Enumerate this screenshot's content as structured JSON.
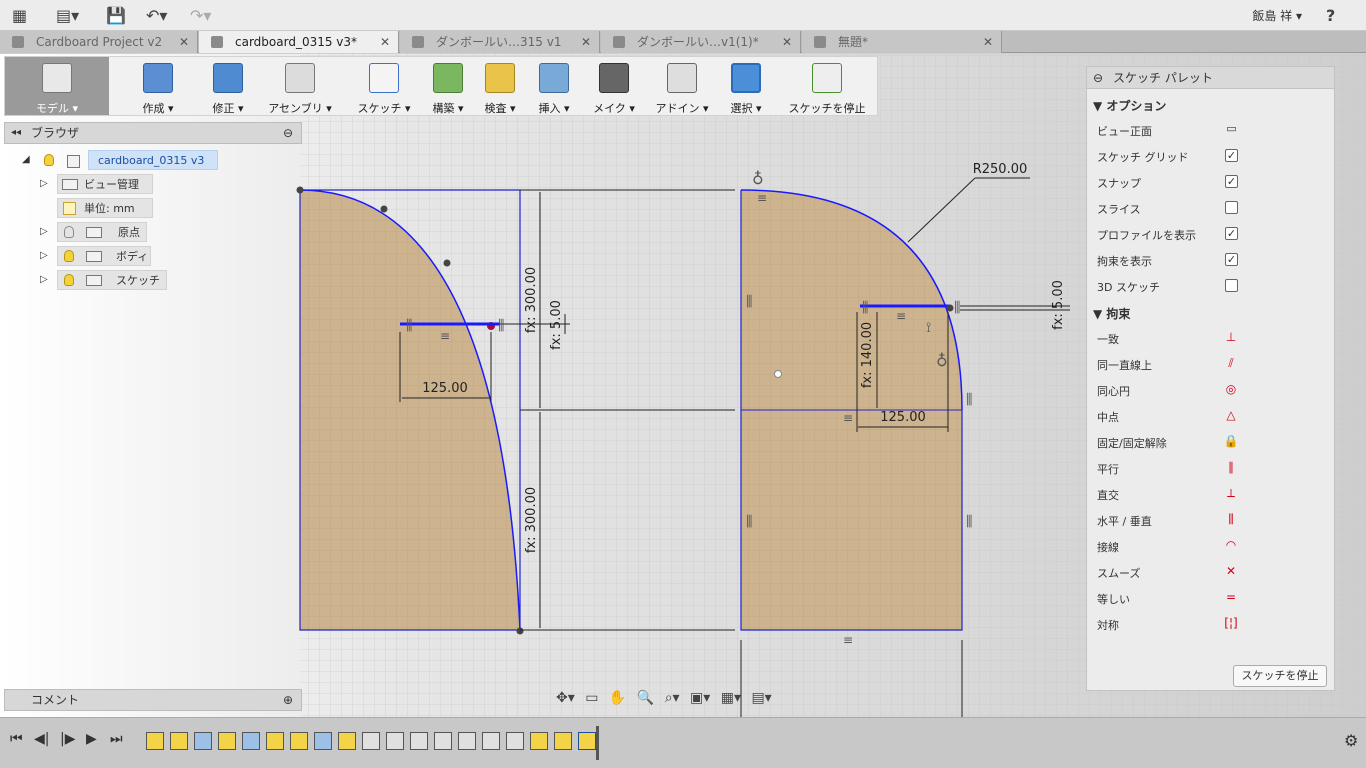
{
  "user": {
    "name": "飯島 祥 ▾",
    "help": "?"
  },
  "tabs": [
    {
      "label": "Cardboard Project v2",
      "close": "✕"
    },
    {
      "label": "cardboard_0315 v3*",
      "close": "✕"
    },
    {
      "label": "ダンボールい…315 v1",
      "close": "✕"
    },
    {
      "label": "ダンボールい…v1(1)*",
      "close": "✕"
    },
    {
      "label": "無題*",
      "close": "✕"
    }
  ],
  "toolbar": [
    {
      "label": "モデル ▾"
    },
    {
      "label": "作成 ▾"
    },
    {
      "label": "修正 ▾"
    },
    {
      "label": "アセンブリ ▾"
    },
    {
      "label": "スケッチ ▾"
    },
    {
      "label": "構築 ▾"
    },
    {
      "label": "検査 ▾"
    },
    {
      "label": "挿入 ▾"
    },
    {
      "label": "メイク ▾"
    },
    {
      "label": "アドイン ▾"
    },
    {
      "label": "選択 ▾"
    },
    {
      "label": "スケッチを停止"
    }
  ],
  "browser": {
    "title": "ブラウザ",
    "root": "cardboard_0315 v3",
    "items": [
      "ビュー管理",
      "単位: mm",
      "原点",
      "ボディ",
      "スケッチ"
    ]
  },
  "comment": {
    "title": "コメント"
  },
  "sketch": {
    "dims": {
      "radius": "R250.00",
      "left_h": "125.00",
      "left_v1": "fx: 300.00",
      "left_v2": "fx: 300.00",
      "left_small": "fx: 5.00",
      "right_h": "125.00",
      "right_v": "fx: 140.00",
      "right_small": "fx: 5.00"
    }
  },
  "palette": {
    "title": "スケッチ パレット",
    "options_title": "オプション",
    "options": [
      {
        "label": "ビュー正面",
        "checked": null
      },
      {
        "label": "スケッチ グリッド",
        "checked": true
      },
      {
        "label": "スナップ",
        "checked": true
      },
      {
        "label": "スライス",
        "checked": false
      },
      {
        "label": "プロファイルを表示",
        "checked": true
      },
      {
        "label": "拘束を表示",
        "checked": true
      },
      {
        "label": "3D スケッチ",
        "checked": false
      }
    ],
    "constraints_title": "拘束",
    "constraints": [
      {
        "label": "一致",
        "icon": "coincident-icon"
      },
      {
        "label": "同一直線上",
        "icon": "collinear-icon"
      },
      {
        "label": "同心円",
        "icon": "concentric-icon"
      },
      {
        "label": "中点",
        "icon": "midpoint-icon"
      },
      {
        "label": "固定/固定解除",
        "icon": "lock-icon"
      },
      {
        "label": "平行",
        "icon": "parallel-icon"
      },
      {
        "label": "直交",
        "icon": "perpendicular-icon"
      },
      {
        "label": "水平 / 垂直",
        "icon": "horizontal-vertical-icon"
      },
      {
        "label": "接線",
        "icon": "tangent-icon"
      },
      {
        "label": "スムーズ",
        "icon": "smooth-icon"
      },
      {
        "label": "等しい",
        "icon": "equal-icon"
      },
      {
        "label": "対称",
        "icon": "symmetry-icon"
      }
    ],
    "stop_button": "スケッチを停止"
  },
  "colors": {
    "accent": "#2a6cb8",
    "sketch_line": "#1a1aff",
    "profile_fill": "#cdb48f",
    "constraint": "#d0021b"
  }
}
